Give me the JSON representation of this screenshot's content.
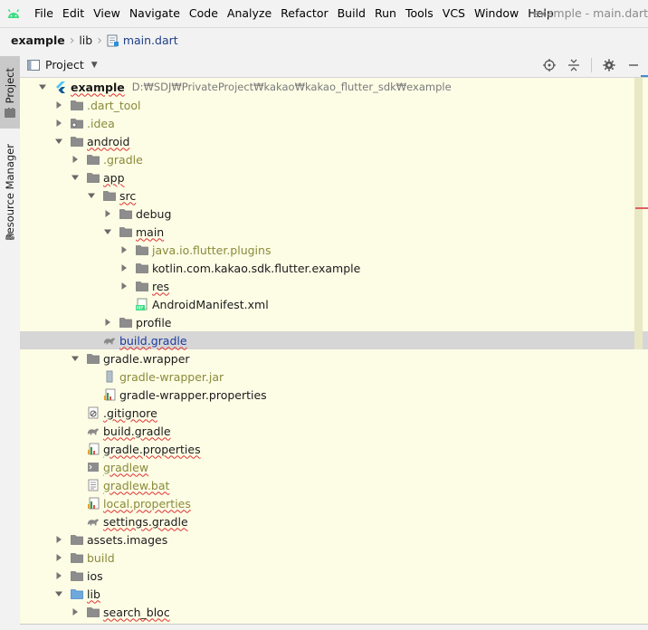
{
  "menubar": {
    "items": [
      "File",
      "Edit",
      "View",
      "Navigate",
      "Code",
      "Analyze",
      "Refactor",
      "Build",
      "Run",
      "Tools",
      "VCS",
      "Window",
      "Help"
    ],
    "title": "example - main.dart"
  },
  "navbar": {
    "crumbs": [
      "example",
      "lib",
      "main.dart"
    ]
  },
  "sidestrip": {
    "project_tab": "1: Project",
    "resource_tab": "Resource Manager"
  },
  "panel": {
    "title": "Project",
    "tools": [
      "locate-icon",
      "collapse-icon",
      "gear-icon",
      "minimize-icon"
    ]
  },
  "tree": {
    "rows": [
      {
        "label": "example",
        "path": "D:₩SDJ₩PrivateProject₩kakao₩kakao_flutter_sdk₩example",
        "depth": 0,
        "arrow": "down",
        "icon": "flutter-icon"
      },
      {
        "label": ".dart_tool",
        "depth": 1,
        "arrow": "right",
        "icon": "folder-icon"
      },
      {
        "label": ".idea",
        "depth": 1,
        "arrow": "right",
        "icon": "folder-settings-icon"
      },
      {
        "label": "android",
        "depth": 1,
        "arrow": "down",
        "icon": "folder-icon"
      },
      {
        "label": ".gradle",
        "depth": 2,
        "arrow": "right",
        "icon": "folder-icon"
      },
      {
        "label": "app",
        "depth": 2,
        "arrow": "down",
        "icon": "folder-icon"
      },
      {
        "label": "src",
        "depth": 3,
        "arrow": "down",
        "icon": "folder-icon"
      },
      {
        "label": "debug",
        "depth": 4,
        "arrow": "right",
        "icon": "folder-icon"
      },
      {
        "label": "main",
        "depth": 4,
        "arrow": "down",
        "icon": "folder-icon"
      },
      {
        "label": "java.io.flutter.plugins",
        "depth": 5,
        "arrow": "right",
        "icon": "folder-icon"
      },
      {
        "label": "kotlin.com.kakao.sdk.flutter.example",
        "depth": 5,
        "arrow": "right",
        "icon": "folder-icon"
      },
      {
        "label": "res",
        "depth": 5,
        "arrow": "right",
        "icon": "folder-icon"
      },
      {
        "label": "AndroidManifest.xml",
        "depth": 5,
        "arrow": "none",
        "icon": "manifest-icon"
      },
      {
        "label": "profile",
        "depth": 4,
        "arrow": "right",
        "icon": "folder-icon"
      },
      {
        "label": "build.gradle",
        "depth": 3,
        "arrow": "none",
        "icon": "gradle-icon"
      },
      {
        "label": "gradle.wrapper",
        "depth": 2,
        "arrow": "down",
        "icon": "folder-icon"
      },
      {
        "label": "gradle-wrapper.jar",
        "depth": 3,
        "arrow": "none",
        "icon": "jar-icon"
      },
      {
        "label": "gradle-wrapper.properties",
        "depth": 3,
        "arrow": "none",
        "icon": "properties-icon"
      },
      {
        "label": ".gitignore",
        "depth": 2,
        "arrow": "none",
        "icon": "gitignore-icon"
      },
      {
        "label": "build.gradle",
        "depth": 2,
        "arrow": "none",
        "icon": "gradle-icon"
      },
      {
        "label": "gradle.properties",
        "depth": 2,
        "arrow": "none",
        "icon": "properties-icon"
      },
      {
        "label": "gradlew",
        "depth": 2,
        "arrow": "none",
        "icon": "script-icon"
      },
      {
        "label": "gradlew.bat",
        "depth": 2,
        "arrow": "none",
        "icon": "text-file-icon"
      },
      {
        "label": "local.properties",
        "depth": 2,
        "arrow": "none",
        "icon": "properties-icon"
      },
      {
        "label": "settings.gradle",
        "depth": 2,
        "arrow": "none",
        "icon": "gradle-icon"
      },
      {
        "label": "assets.images",
        "depth": 1,
        "arrow": "right",
        "icon": "folder-icon"
      },
      {
        "label": "build",
        "depth": 1,
        "arrow": "right",
        "icon": "folder-icon"
      },
      {
        "label": "ios",
        "depth": 1,
        "arrow": "right",
        "icon": "folder-icon"
      },
      {
        "label": "lib",
        "depth": 1,
        "arrow": "down",
        "icon": "folder-blue-icon"
      },
      {
        "label": "search_bloc",
        "depth": 2,
        "arrow": "right",
        "icon": "folder-icon"
      }
    ],
    "selected_index": 14
  },
  "colors": {
    "tree_bg": "#fdfde6",
    "selection": "#d6d6d6",
    "link": "#1a3aa0",
    "muted": "#8a8a3a",
    "flutter_blue": "#2b8fdc",
    "android_green": "#3ddc84",
    "error_squiggle": "#e03030"
  }
}
